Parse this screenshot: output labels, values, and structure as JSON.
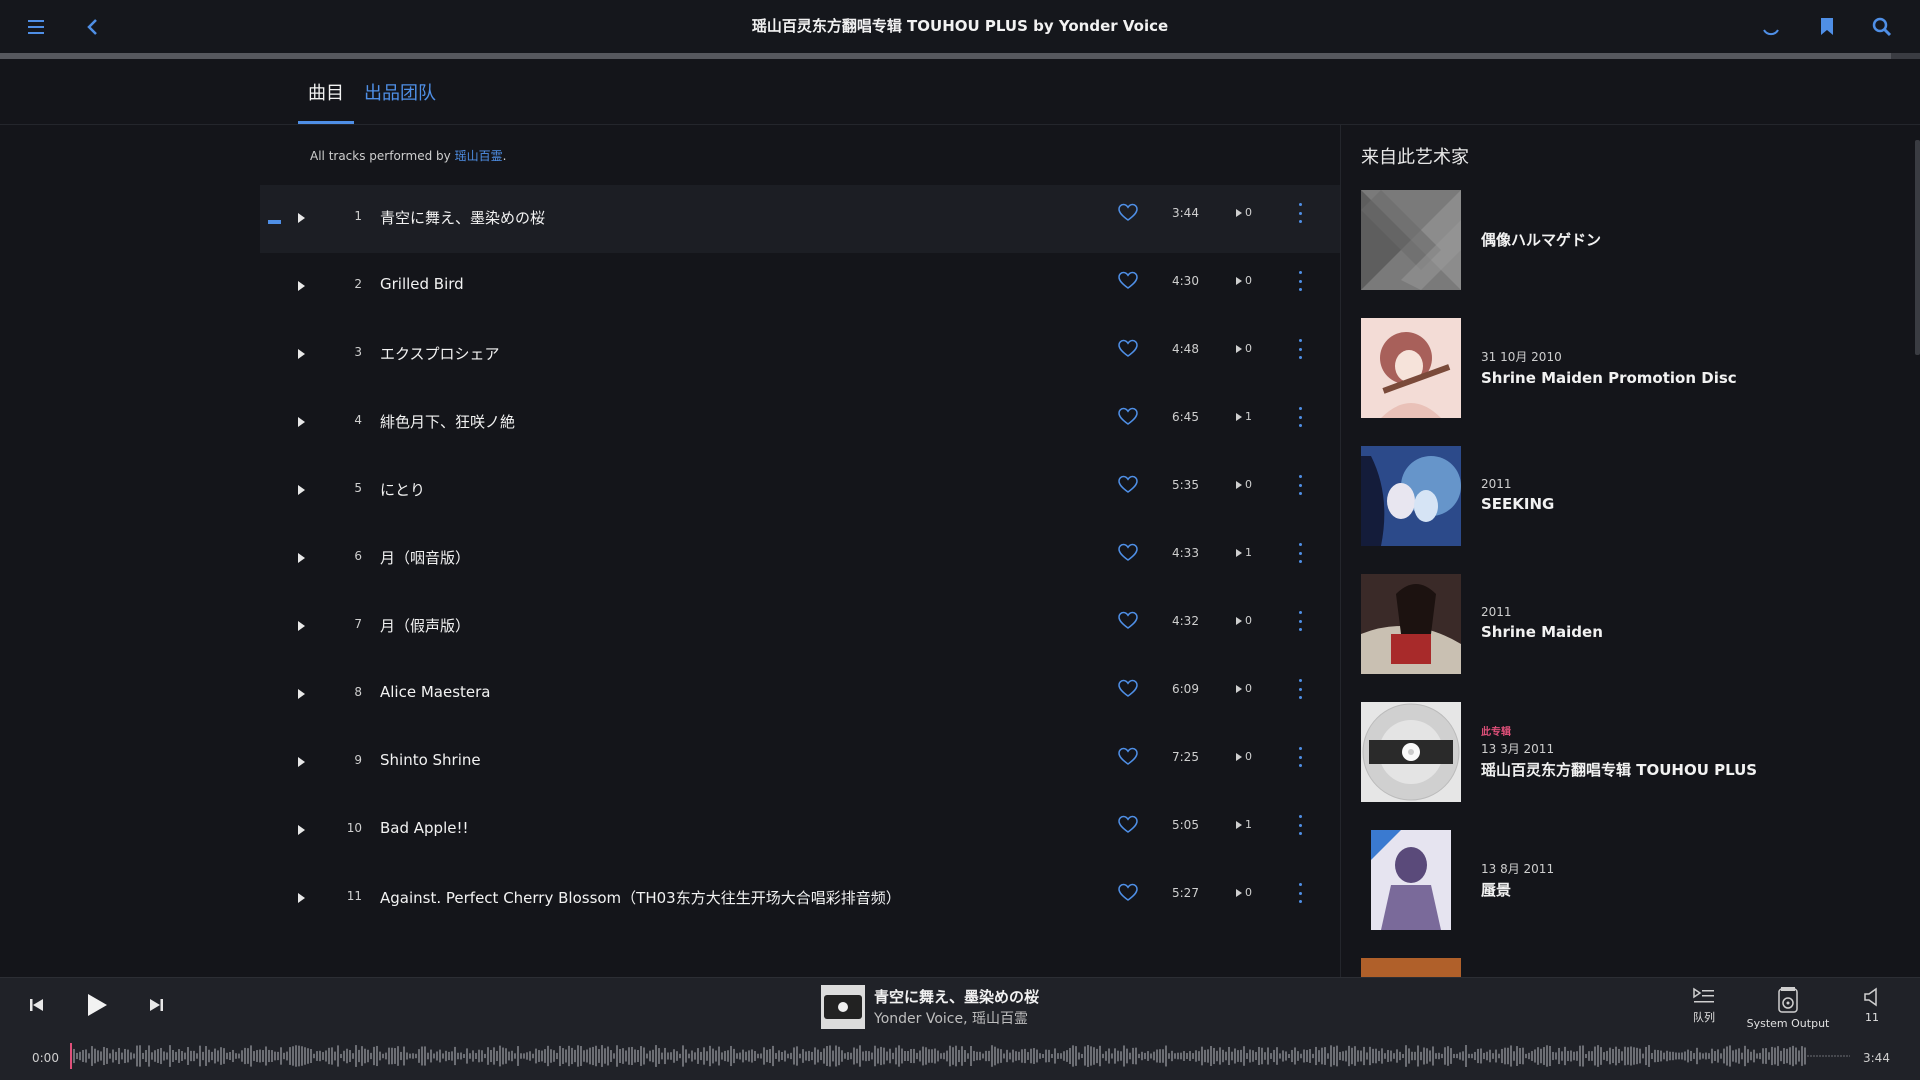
{
  "header": {
    "title": "瑶山百灵东方翻唱专辑 TOUHOU PLUS by Yonder Voice",
    "progress_fraction": 0.985
  },
  "tabs": [
    {
      "label": "曲目",
      "active": true
    },
    {
      "label": "出品团队",
      "active": false
    }
  ],
  "credit": {
    "prefix": "All tracks performed by ",
    "artist": "瑶山百霊",
    "suffix": "."
  },
  "tracks": [
    {
      "num": "1",
      "name": "青空に舞え、墨染めの桜",
      "duration": "3:44",
      "plays": "0",
      "selected": true
    },
    {
      "num": "2",
      "name": "Grilled Bird",
      "duration": "4:30",
      "plays": "0"
    },
    {
      "num": "3",
      "name": "エクスプロシェア",
      "duration": "4:48",
      "plays": "0"
    },
    {
      "num": "4",
      "name": "緋色月下、狂咲ノ絶",
      "duration": "6:45",
      "plays": "1"
    },
    {
      "num": "5",
      "name": "にとり",
      "duration": "5:35",
      "plays": "0"
    },
    {
      "num": "6",
      "name": "月（咽音版）",
      "duration": "4:33",
      "plays": "1"
    },
    {
      "num": "7",
      "name": "月（假声版）",
      "duration": "4:32",
      "plays": "0"
    },
    {
      "num": "8",
      "name": "Alice Maestera",
      "duration": "6:09",
      "plays": "0"
    },
    {
      "num": "9",
      "name": "Shinto Shrine",
      "duration": "7:25",
      "plays": "0"
    },
    {
      "num": "10",
      "name": "Bad Apple!!",
      "duration": "5:05",
      "plays": "1"
    },
    {
      "num": "11",
      "name": "Against. Perfect Cherry Blossom（TH03东方大往生开场大合唱彩排音频）",
      "duration": "5:27",
      "plays": "0"
    }
  ],
  "right_panel": {
    "heading": "来自此艺术家",
    "albums": [
      {
        "tag": "",
        "date": "",
        "name": "偶像ハルマゲドン",
        "cover": "gray-pattern"
      },
      {
        "tag": "",
        "date": "31 10月 2010",
        "name": "Shrine Maiden Promotion Disc",
        "cover": "pink-flute"
      },
      {
        "tag": "",
        "date": "2011",
        "name": "SEEKING",
        "cover": "blue-girls"
      },
      {
        "tag": "",
        "date": "2011",
        "name": "Shrine Maiden",
        "cover": "dark-red"
      },
      {
        "tag": "此专辑",
        "date": "13 3月 2011",
        "name": "瑶山百灵东方翻唱专辑 TOUHOU PLUS",
        "cover": "cd-disc"
      },
      {
        "tag": "",
        "date": "13 8月 2011",
        "name": "蜃景",
        "cover": "purple-girl"
      }
    ]
  },
  "player": {
    "now_playing_title": "青空に舞え、墨染めの桜",
    "now_playing_artist": "Yonder Voice, 瑶山百霊",
    "elapsed": "0:00",
    "total": "3:44",
    "queue_label": "队列",
    "output_label": "System Output",
    "volume": "11"
  },
  "colors": {
    "accent": "#4f8fe6",
    "background": "#14151a",
    "tag": "#e0507a"
  }
}
